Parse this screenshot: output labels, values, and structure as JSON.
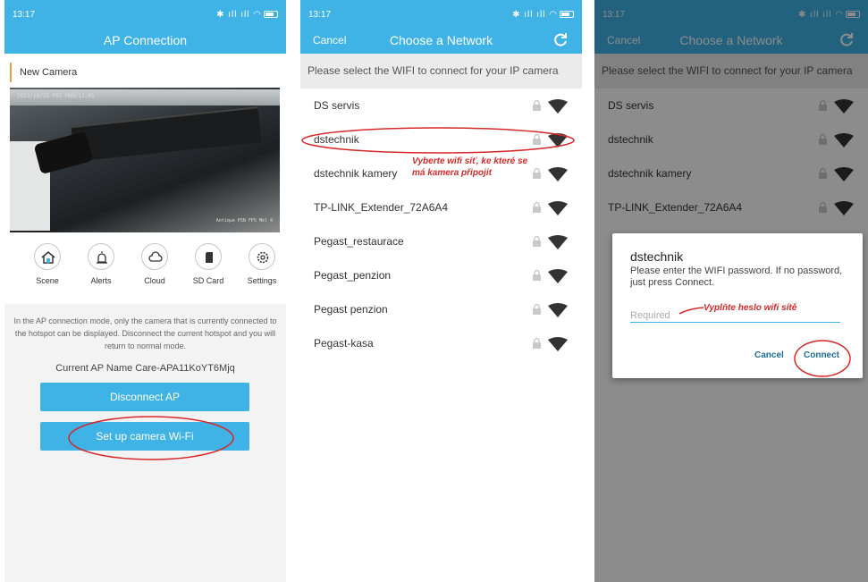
{
  "colors": {
    "accent": "#3fb2e6",
    "annotation": "#d62828",
    "divider_accent": "#f39a3c"
  },
  "status_bar": {
    "time": "13:17",
    "icons": "bluetooth, signal, signal, wifi, battery"
  },
  "screen1": {
    "title": "AP Connection",
    "camera_name": "New Camera",
    "video_osd": "2023/10/25  PRI  MON/11:01",
    "video_osd2": "Antique PSN  FPS  Mel 4",
    "actions": [
      {
        "label": "Scene",
        "icon": "home-icon"
      },
      {
        "label": "Alerts",
        "icon": "alarm-icon"
      },
      {
        "label": "Cloud",
        "icon": "cloud-icon"
      },
      {
        "label": "SD Card",
        "icon": "sd-card-icon"
      },
      {
        "label": "Settings",
        "icon": "settings-icon"
      }
    ],
    "info_text": "In the AP connection mode, only the camera that is currently connected to the hotspot can be displayed. Disconnect the current hotspot and you will return to normal mode.",
    "ap_name": "Current AP Name Care-APA11KoYT6Mjq",
    "disconnect_label": "Disconnect AP",
    "setup_label": "Set up camera Wi-Fi"
  },
  "screen2": {
    "cancel": "Cancel",
    "title": "Choose a Network",
    "prompt": "Please select the WIFI to connect for your IP camera",
    "networks": [
      "DS servis",
      "dstechnik",
      "dstechnik kamery",
      "TP-LINK_Extender_72A6A4",
      "Pegast_restaurace",
      "Pegast_penzion",
      "Pegast penzion",
      "Pegast-kasa"
    ],
    "annotation_line1": "Vyberte wifi síť, ke které se",
    "annotation_line2": "má kamera připojit"
  },
  "screen3": {
    "cancel": "Cancel",
    "title": "Choose a Network",
    "prompt": "Please select the WIFI to connect for your IP camera",
    "networks": [
      "DS servis",
      "dstechnik",
      "dstechnik kamery",
      "TP-LINK_Extender_72A6A4"
    ],
    "dialog_title": "dstechnik",
    "dialog_message": "Please enter the WIFI password. If no password, just press Connect.",
    "password_placeholder": "Required",
    "cancel_btn": "Cancel",
    "connect_btn": "Connect",
    "annotation": "Vyplňte heslo wifi sítě"
  }
}
